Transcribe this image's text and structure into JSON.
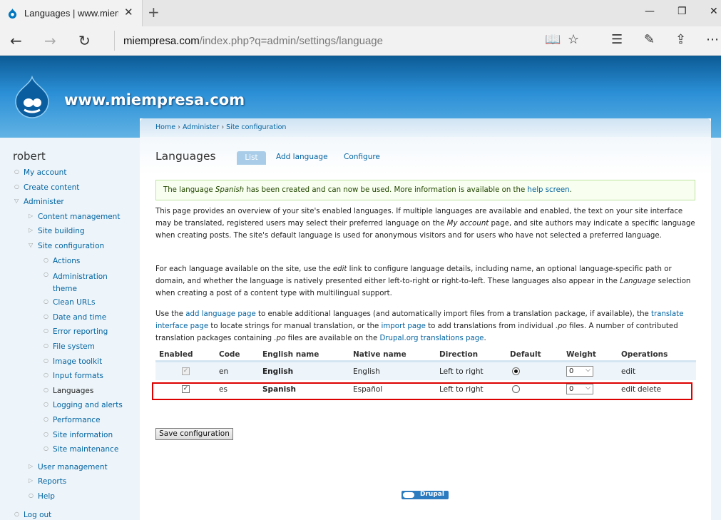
{
  "browser": {
    "tab_title": "Languages | www.miemp",
    "close_tab": "✕",
    "new_tab": "+",
    "url_host": "miempresa.com",
    "url_path": "/index.php?q=admin/settings/language",
    "window_controls": {
      "minimize": "—",
      "restore": "❐",
      "close": "✕"
    },
    "nav": {
      "back": "←",
      "forward": "→",
      "refresh": "↻"
    },
    "tools": {
      "reading_view": "📖",
      "favorite": "☆",
      "hub": "☰",
      "notes": "✎",
      "share": "⇪",
      "more": "⋯"
    }
  },
  "site": {
    "name": "www.miempresa.com"
  },
  "sidebar": {
    "username": "robert",
    "items": [
      {
        "label": "My account",
        "level": 0
      },
      {
        "label": "Create content",
        "level": 0
      },
      {
        "label": "Administer",
        "level": 0
      },
      {
        "label": "Content management",
        "level": 1
      },
      {
        "label": "Site building",
        "level": 1
      },
      {
        "label": "Site configuration",
        "level": 1
      },
      {
        "label": "Actions",
        "level": 2
      },
      {
        "label": "Administration theme",
        "level": 2
      },
      {
        "label": "Clean URLs",
        "level": 2
      },
      {
        "label": "Date and time",
        "level": 2
      },
      {
        "label": "Error reporting",
        "level": 2
      },
      {
        "label": "File system",
        "level": 2
      },
      {
        "label": "Image toolkit",
        "level": 2
      },
      {
        "label": "Input formats",
        "level": 2
      },
      {
        "label": "Languages",
        "level": 2
      },
      {
        "label": "Logging and alerts",
        "level": 2
      },
      {
        "label": "Performance",
        "level": 2
      },
      {
        "label": "Site information",
        "level": 2
      },
      {
        "label": "Site maintenance",
        "level": 2
      },
      {
        "label": "User management",
        "level": 1
      },
      {
        "label": "Reports",
        "level": 1
      },
      {
        "label": "Help",
        "level": 1
      },
      {
        "label": "Log out",
        "level": 0
      }
    ]
  },
  "breadcrumb": {
    "home": "Home",
    "administer": "Administer",
    "site_config": "Site configuration",
    "sep": "›"
  },
  "page": {
    "title": "Languages",
    "tabs": {
      "list": "List",
      "add": "Add language",
      "configure": "Configure"
    }
  },
  "message": {
    "pre": "The language ",
    "lang": "Spanish",
    "post": " has been created and can now be used. More information is available on the ",
    "link": "help screen",
    "end": "."
  },
  "help": {
    "p1_a": "This page provides an overview of your site's enabled languages. If multiple languages are available and enabled, the text on your site interface may be translated, registered users may select their preferred language on the ",
    "p1_em": "My account",
    "p1_b": " page, and site authors may indicate a specific language when creating posts. The site's default language is used for anonymous visitors and for users who have not selected a preferred language.",
    "p2_a": "For each language available on the site, use the ",
    "p2_em1": "edit",
    "p2_b": " link to configure language details, including name, an optional language-specific path or domain, and whether the language is natively presented either left-to-right or right-to-left. These languages also appear in the ",
    "p2_em2": "Language",
    "p2_c": " selection when creating a post of a content type with multilingual support.",
    "p3_a": "Use the ",
    "p3_link1": "add language page",
    "p3_b": " to enable additional languages (and automatically import files from a translation package, if available), the ",
    "p3_link2": "translate interface page",
    "p3_c": " to locate strings for manual translation, or the ",
    "p3_link3": "import page",
    "p3_d": " to add translations from individual ",
    "p3_em1": ".po",
    "p3_e": " files. A number of contributed translation packages containing ",
    "p3_em2": ".po",
    "p3_f": " files are available on the ",
    "p3_link4": "Drupal.org translations page",
    "p3_g": "."
  },
  "table": {
    "headers": {
      "enabled": "Enabled",
      "code": "Code",
      "english": "English name",
      "native": "Native name",
      "direction": "Direction",
      "default": "Default",
      "weight": "Weight",
      "operations": "Operations"
    },
    "rows": [
      {
        "enabled": true,
        "enabled_locked": true,
        "code": "en",
        "english": "English",
        "native": "English",
        "direction": "Left to right",
        "default": true,
        "weight": "0",
        "edit": "edit",
        "delete": ""
      },
      {
        "enabled": true,
        "enabled_locked": false,
        "code": "es",
        "english": "Spanish",
        "native": "Español",
        "direction": "Left to right",
        "default": false,
        "weight": "0",
        "edit": "edit",
        "delete": "delete"
      }
    ],
    "check_mark": "✓",
    "dropdown_arrow": "⌵"
  },
  "save_button": "Save configuration",
  "footer_badge": "Drupal",
  "colors": {
    "header_blue": "#1e7fc6",
    "link": "#0062a0",
    "highlight": "#dd0000",
    "message_border": "#bee5a0"
  }
}
